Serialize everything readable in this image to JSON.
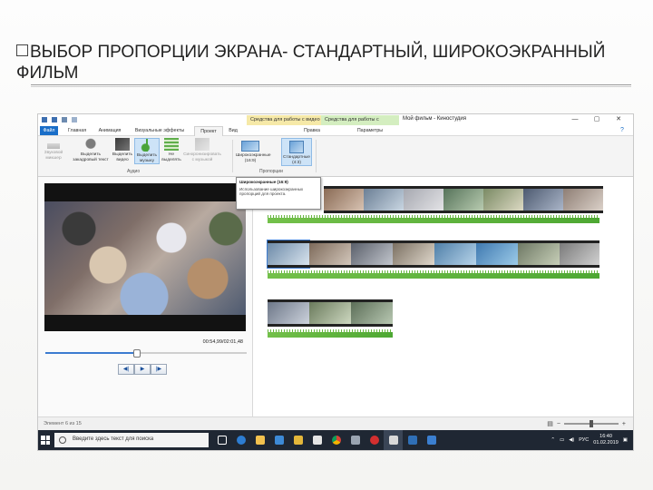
{
  "slide": {
    "title": "ВЫБОР ПРОПОРЦИИ ЭКРАНА- СТАНДАРТНЫЙ, ШИРОКОЭКРАННЫЙ ФИЛЬМ"
  },
  "window": {
    "title": "Мой фильм - Киностудия",
    "context_video": "Средства для работы с видео",
    "context_music": "Средства для работы с музыкой",
    "context_video_sub": "Правка",
    "context_music_sub": "Параметры",
    "minimize": "—",
    "maximize": "▢",
    "close": "✕"
  },
  "ribbon_tabs": [
    {
      "label": "Файл"
    },
    {
      "label": "Главная"
    },
    {
      "label": "Анимация"
    },
    {
      "label": "Визуальные эффекты"
    },
    {
      "label": "Проект"
    },
    {
      "label": "Вид"
    }
  ],
  "ribbon": {
    "btn_sound_mix": "Звуковой микшер",
    "btn_highlight_text": "Выделить закадровый текст",
    "btn_highlight_video": "Выделить видео",
    "btn_highlight_music": "Выделить музыку",
    "btn_no_highlight": "Не выделять",
    "btn_autofit_music": "Синхронизировать с музыкой",
    "btn_widescreen": "Широкоэкранные (16:9)",
    "btn_standard": "Стандартные (4:3)",
    "group_audio": "Аудио",
    "group_proportions": "Пропорции"
  },
  "tooltip": {
    "header": "Широкоэкранные (16:9)",
    "body": "Использование широкоэкранных пропорций для проекта."
  },
  "player": {
    "timecode": "00:54,99/02:01,48",
    "progress": 0.45,
    "btn_prev": "◀|",
    "btn_play": "▶",
    "btn_next": "|▶"
  },
  "status": {
    "text": "Элемент 6 из 15"
  },
  "taskbar": {
    "search_placeholder": "Введите здесь текст для поиска",
    "lang": "РУС",
    "time": "16:40",
    "date": "01.02.2019",
    "apps": [
      "task-view",
      "edge",
      "explorer",
      "store",
      "photos",
      "mail",
      "chrome",
      "opera",
      "movie-maker",
      "media",
      "video"
    ]
  },
  "colors": {
    "accent": "#1a6ec8",
    "audio_green": "#5bb53a",
    "taskbar": "#1f2733"
  }
}
